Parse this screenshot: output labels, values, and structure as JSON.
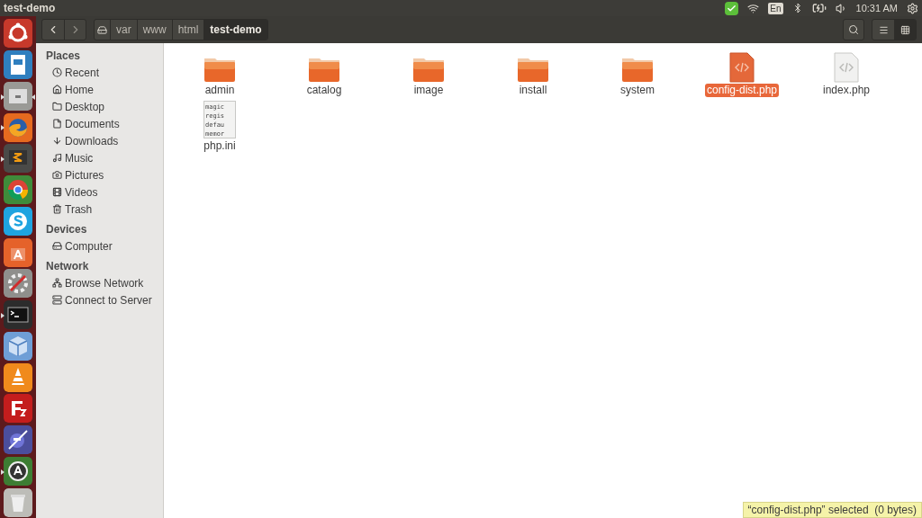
{
  "top_bar": {
    "title": "test-demo",
    "keyboard": "En",
    "clock": "10:31 AM"
  },
  "launcher": [
    {
      "kind": "dash",
      "running": false,
      "focused": false
    },
    {
      "kind": "writer",
      "running": false,
      "focused": false
    },
    {
      "kind": "files",
      "running": true,
      "focused": true
    },
    {
      "kind": "firefox",
      "running": true,
      "focused": false
    },
    {
      "kind": "sublime",
      "running": true,
      "focused": false
    },
    {
      "kind": "chrome",
      "running": false,
      "focused": false
    },
    {
      "kind": "skype",
      "running": false,
      "focused": false
    },
    {
      "kind": "software",
      "running": false,
      "focused": false
    },
    {
      "kind": "settings",
      "running": false,
      "focused": false
    },
    {
      "kind": "terminal",
      "running": true,
      "focused": false
    },
    {
      "kind": "virtualbox",
      "running": false,
      "focused": false
    },
    {
      "kind": "vlc",
      "running": false,
      "focused": false
    },
    {
      "kind": "filezilla",
      "running": false,
      "focused": false
    },
    {
      "kind": "eclipse",
      "running": false,
      "focused": false
    },
    {
      "kind": "updater",
      "running": true,
      "focused": false
    },
    {
      "kind": "trash",
      "running": false,
      "focused": false
    }
  ],
  "path_bar": [
    {
      "label": "var",
      "selected": false
    },
    {
      "label": "www",
      "selected": false
    },
    {
      "label": "html",
      "selected": false
    },
    {
      "label": "test-demo",
      "selected": true
    }
  ],
  "view_buttons": [
    {
      "kind": "list",
      "selected": false
    },
    {
      "kind": "grid",
      "selected": true
    }
  ],
  "sidebar": [
    {
      "heading": "Places",
      "items": [
        {
          "label": "Recent",
          "kind": "recent"
        },
        {
          "label": "Home",
          "kind": "home"
        },
        {
          "label": "Desktop",
          "kind": "desktop"
        },
        {
          "label": "Documents",
          "kind": "documents"
        },
        {
          "label": "Downloads",
          "kind": "downloads"
        },
        {
          "label": "Music",
          "kind": "music"
        },
        {
          "label": "Pictures",
          "kind": "pictures"
        },
        {
          "label": "Videos",
          "kind": "videos"
        },
        {
          "label": "Trash",
          "kind": "trash"
        }
      ]
    },
    {
      "heading": "Devices",
      "items": [
        {
          "label": "Computer",
          "kind": "computer"
        }
      ]
    },
    {
      "heading": "Network",
      "items": [
        {
          "label": "Browse Network",
          "kind": "network"
        },
        {
          "label": "Connect to Server",
          "kind": "server"
        }
      ]
    }
  ],
  "files": [
    {
      "name": "admin",
      "kind": "folder",
      "selected": false
    },
    {
      "name": "catalog",
      "kind": "folder",
      "selected": false
    },
    {
      "name": "image",
      "kind": "folder",
      "selected": false
    },
    {
      "name": "install",
      "kind": "folder",
      "selected": false
    },
    {
      "name": "system",
      "kind": "folder",
      "selected": false
    },
    {
      "name": "config-dist.php",
      "kind": "php",
      "selected": true
    },
    {
      "name": "index.php",
      "kind": "php",
      "selected": false
    },
    {
      "name": "php.ini",
      "kind": "text",
      "selected": false,
      "preview": [
        "magic",
        "regis",
        "defau",
        "memor"
      ]
    }
  ],
  "status_bar": "“config-dist.php” selected  (0 bytes)"
}
